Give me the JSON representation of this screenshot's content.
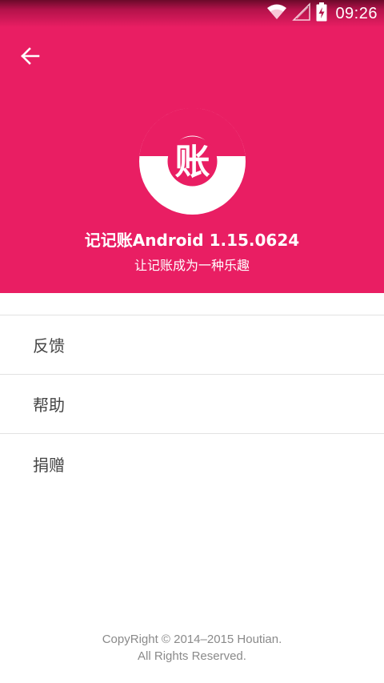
{
  "status_bar": {
    "time": "09:26",
    "icons": [
      "wifi-icon",
      "signal-icon",
      "battery-charging-icon"
    ]
  },
  "header": {
    "back_icon": "arrow-left-icon",
    "logo_char": "账",
    "app_title": "记记账Android 1.15.0624",
    "slogan": "让记账成为一种乐趣"
  },
  "menu": {
    "items": [
      {
        "label": "反馈"
      },
      {
        "label": "帮助"
      },
      {
        "label": "捐赠"
      }
    ]
  },
  "footer": {
    "copyright": "CopyRight © 2014–2015 Houtian.",
    "rights": "All Rights Reserved."
  },
  "colors": {
    "primary": "#e91e63",
    "text_menu": "#444444",
    "text_footer": "#8a8a8a",
    "divider": "#e2e2e2"
  }
}
